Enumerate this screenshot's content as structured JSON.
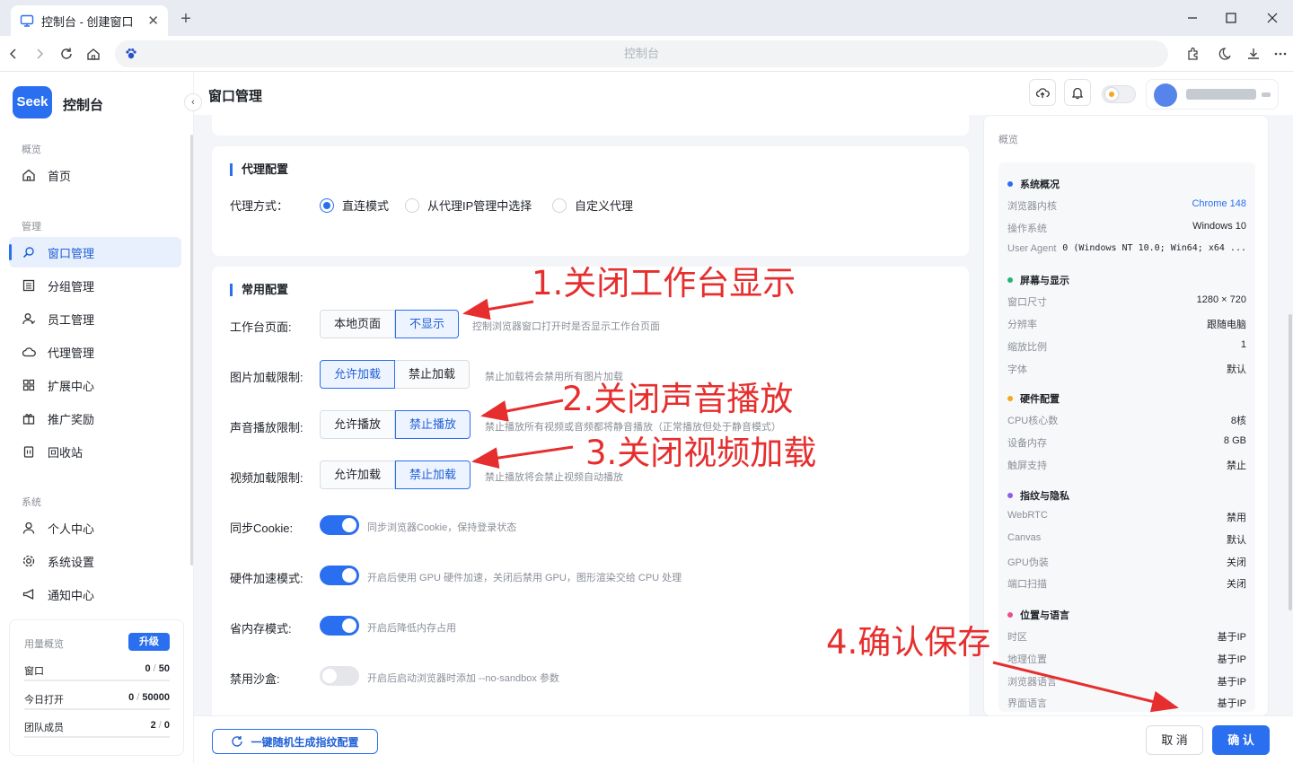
{
  "browser": {
    "tab_title": "控制台 - 创建窗口",
    "address": "控制台"
  },
  "sidebar": {
    "logo": "Seek",
    "brand": "控制台",
    "sections": [
      {
        "label": "概览",
        "items": [
          {
            "label": "首页",
            "icon": "home-icon"
          }
        ]
      },
      {
        "label": "管理",
        "items": [
          {
            "label": "窗口管理",
            "icon": "search-window-icon",
            "active": true
          },
          {
            "label": "分组管理",
            "icon": "group-icon"
          },
          {
            "label": "员工管理",
            "icon": "staff-icon"
          },
          {
            "label": "代理管理",
            "icon": "cloud-icon"
          },
          {
            "label": "扩展中心",
            "icon": "grid-icon"
          },
          {
            "label": "推广奖励",
            "icon": "gift-icon"
          },
          {
            "label": "回收站",
            "icon": "trash-icon"
          }
        ]
      },
      {
        "label": "系统",
        "items": [
          {
            "label": "个人中心",
            "icon": "user-icon"
          },
          {
            "label": "系统设置",
            "icon": "gear-icon"
          },
          {
            "label": "通知中心",
            "icon": "megaphone-icon"
          }
        ]
      }
    ],
    "usage": {
      "title": "用量概览",
      "upgrade": "升级",
      "rows": [
        {
          "label": "窗口",
          "used": "0",
          "total": "50"
        },
        {
          "label": "今日打开",
          "used": "0",
          "total": "50000"
        },
        {
          "label": "团队成员",
          "used": "2",
          "total": "0"
        }
      ]
    }
  },
  "header": {
    "title": "窗口管理"
  },
  "proxy": {
    "title": "代理配置",
    "label": "代理方式：",
    "options": [
      "直连模式",
      "从代理IP管理中选择",
      "自定义代理"
    ],
    "selected": "直连模式"
  },
  "common": {
    "title": "常用配置",
    "rows": [
      {
        "label": "工作台页面:",
        "options": [
          "本地页面",
          "不显示"
        ],
        "selected": "不显示",
        "hint": "控制浏览器窗口打开时是否显示工作台页面"
      },
      {
        "label": "图片加载限制:",
        "options": [
          "允许加载",
          "禁止加载"
        ],
        "selected": "允许加载",
        "hint": "禁止加载将会禁用所有图片加载"
      },
      {
        "label": "声音播放限制:",
        "options": [
          "允许播放",
          "禁止播放"
        ],
        "selected": "禁止播放",
        "hint": "禁止播放所有视频或音频都将静音播放（正常播放但处于静音模式）"
      },
      {
        "label": "视频加载限制:",
        "options": [
          "允许加载",
          "禁止加载"
        ],
        "selected": "禁止加载",
        "hint": "禁止播放将会禁止视频自动播放"
      }
    ],
    "toggles": [
      {
        "label": "同步Cookie:",
        "on": true,
        "hint": "同步浏览器Cookie，保持登录状态"
      },
      {
        "label": "硬件加速模式:",
        "on": true,
        "hint": "开启后使用 GPU 硬件加速，关闭后禁用 GPU，图形渲染交给 CPU 处理"
      },
      {
        "label": "省内存模式:",
        "on": true,
        "hint": "开启后降低内存占用"
      },
      {
        "label": "禁用沙盒:",
        "on": false,
        "hint": "开启后启动浏览器时添加 --no-sandbox 参数"
      }
    ]
  },
  "overview": {
    "title": "概览",
    "groups": [
      {
        "title": "系统概况",
        "color": "#2a6ff0",
        "rows": [
          {
            "k": "浏览器内核",
            "v": "Chrome 148",
            "accent": true
          },
          {
            "k": "操作系统",
            "v": "Windows 10"
          },
          {
            "k": "User Agent",
            "v": "0 (Windows NT 10.0; Win64; x64 ..."
          }
        ]
      },
      {
        "title": "屏幕与显示",
        "color": "#22b573",
        "rows": [
          {
            "k": "窗口尺寸",
            "v": "1280 × 720"
          },
          {
            "k": "分辨率",
            "v": "跟随电脑"
          },
          {
            "k": "缩放比例",
            "v": "1"
          },
          {
            "k": "字体",
            "v": "默认"
          }
        ]
      },
      {
        "title": "硬件配置",
        "color": "#f5a623",
        "rows": [
          {
            "k": "CPU核心数",
            "v": "8核"
          },
          {
            "k": "设备内存",
            "v": "8 GB"
          },
          {
            "k": "触屏支持",
            "v": "禁止"
          }
        ]
      },
      {
        "title": "指纹与隐私",
        "color": "#8e5cf0",
        "rows": [
          {
            "k": "WebRTC",
            "v": "禁用"
          },
          {
            "k": "Canvas",
            "v": "默认"
          },
          {
            "k": "GPU伪装",
            "v": "关闭"
          },
          {
            "k": "端口扫描",
            "v": "关闭"
          }
        ]
      },
      {
        "title": "位置与语言",
        "color": "#ee4d8b",
        "rows": [
          {
            "k": "时区",
            "v": "基于IP"
          },
          {
            "k": "地理位置",
            "v": "基于IP"
          },
          {
            "k": "浏览器语言",
            "v": "基于IP"
          },
          {
            "k": "界面语言",
            "v": "基于IP"
          }
        ]
      }
    ]
  },
  "footer": {
    "generate": "一键随机生成指纹配置",
    "cancel": "取 消",
    "confirm": "确 认"
  },
  "annotations": {
    "a1": "1.关闭工作台显示",
    "a2": "2.关闭声音播放",
    "a3": "3.关闭视频加载",
    "a4": "4.确认保存"
  }
}
